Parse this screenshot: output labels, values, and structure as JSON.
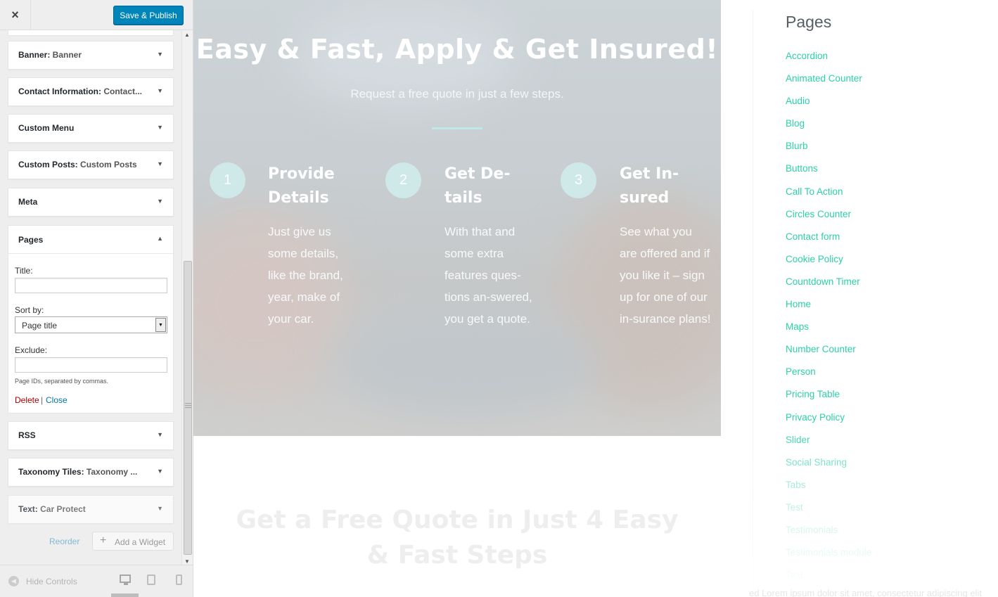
{
  "header": {
    "close_label": "×",
    "publish_label": "Save & Publish"
  },
  "widgets": [
    {
      "name": "Banner:",
      "sub": " Banner"
    },
    {
      "name": "Contact Information:",
      "sub": " Contact..."
    },
    {
      "name": "Custom Menu",
      "sub": ""
    },
    {
      "name": "Custom Posts:",
      "sub": " Custom Posts"
    },
    {
      "name": "Meta",
      "sub": ""
    }
  ],
  "widgets_after": [
    {
      "name": "RSS",
      "sub": ""
    },
    {
      "name": "Taxonomy Tiles:",
      "sub": " Taxonomy ..."
    },
    {
      "name": "Text:",
      "sub": " Car Protect"
    }
  ],
  "pages_widget": {
    "title": "Pages",
    "title_label": "Title:",
    "title_value": "",
    "sort_label": "Sort by:",
    "sort_value": "Page title",
    "exclude_label": "Exclude:",
    "exclude_value": "",
    "exclude_help": "Page IDs, separated by commas.",
    "delete_label": "Delete",
    "separator": "|",
    "close_label": "Close"
  },
  "actions": {
    "reorder_label": "Reorder",
    "add_widget_label": "Add a Widget",
    "add_icon": "+"
  },
  "footer": {
    "hide_controls_label": "Hide Controls",
    "active_device": "desktop"
  },
  "hero": {
    "title": "Easy & Fast, Apply & Get Insured!",
    "subtitle": "Request a free quote in just a few steps.",
    "steps": [
      {
        "num": "1",
        "title": "Provide Details",
        "text": "Just give us some details, like the brand, year, make of your car."
      },
      {
        "num": "2",
        "title": "Get De-tails",
        "text": "With that and some extra features ques-tions an-swered, you get a quote."
      },
      {
        "num": "3",
        "title": "Get In-sured",
        "text": "See what you are offered and if you like it – sign up for one of our in-surance plans!"
      }
    ]
  },
  "below": {
    "title": "Get a Free Quote in Just 4 Easy & Fast Steps"
  },
  "right": {
    "heading": "Pages",
    "pages": [
      "Accordion",
      "Animated Counter",
      "Audio",
      "Blog",
      "Blurb",
      "Buttons",
      "Call To Action",
      "Circles Counter",
      "Contact form",
      "Cookie Policy",
      "Countdown Timer",
      "Home",
      "Maps",
      "Number Counter",
      "Person",
      "Pricing Table",
      "Privacy Policy",
      "Slider",
      "Social Sharing",
      "Tabs",
      "Test",
      "Testimonials",
      "Testimonials module",
      "Text"
    ],
    "cut_text": "ed Lorem ipsum dolor sit amet, consectetur adipiscing elit"
  },
  "colors": {
    "accent": "#0085ba",
    "link": "#2bd0a8",
    "delete": "#aa0000"
  }
}
